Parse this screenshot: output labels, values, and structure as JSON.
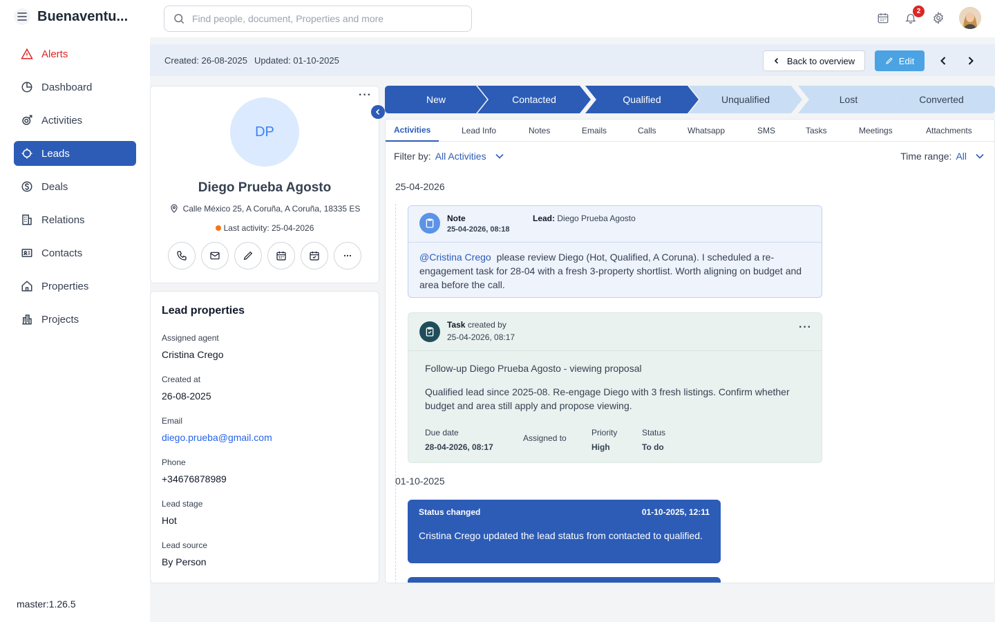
{
  "app": {
    "brand": "Buenaventu...",
    "version": "master:1.26.5"
  },
  "search": {
    "placeholder": "Find people, document, Properties and more"
  },
  "notifications": {
    "count": "2"
  },
  "nav": [
    {
      "label": "Alerts",
      "icon": "alert-triangle-icon"
    },
    {
      "label": "Dashboard",
      "icon": "pie-chart-icon"
    },
    {
      "label": "Activities",
      "icon": "activity-icon"
    },
    {
      "label": "Leads",
      "icon": "leads-icon"
    },
    {
      "label": "Deals",
      "icon": "dollar-icon"
    },
    {
      "label": "Relations",
      "icon": "building-icon"
    },
    {
      "label": "Contacts",
      "icon": "contact-card-icon"
    },
    {
      "label": "Properties",
      "icon": "home-icon"
    },
    {
      "label": "Projects",
      "icon": "city-icon"
    }
  ],
  "meta": {
    "created": "Created: 26-08-2025",
    "updated": "Updated: 01-10-2025"
  },
  "buttons": {
    "back": "Back to overview",
    "edit": "Edit"
  },
  "profile": {
    "initials": "DP",
    "name": "Diego Prueba Agosto",
    "address": "Calle México 25, A Coruña, A Coruña, 18335 ES",
    "last_activity": "Last activity: 25-04-2026"
  },
  "lead_properties": {
    "title": "Lead properties",
    "fields": [
      {
        "label": "Assigned agent",
        "value": "Cristina Crego"
      },
      {
        "label": "Created at",
        "value": "26-08-2025"
      },
      {
        "label": "Email",
        "value": "diego.prueba@gmail.com"
      },
      {
        "label": "Phone",
        "value": "+34676878989"
      },
      {
        "label": "Lead stage",
        "value": "Hot"
      },
      {
        "label": "Lead source",
        "value": "By Person"
      }
    ]
  },
  "stages": [
    "New",
    "Contacted",
    "Qualified",
    "Unqualified",
    "Lost",
    "Converted"
  ],
  "stage_colors": {
    "active": "#2c5cb6",
    "inactive": "#c9def4"
  },
  "tabs": [
    "Activities",
    "Lead Info",
    "Notes",
    "Emails",
    "Calls",
    "Whatsapp",
    "SMS",
    "Tasks",
    "Meetings",
    "Attachments"
  ],
  "filter": {
    "label": "Filter by:",
    "value": "All Activities"
  },
  "time_range": {
    "label": "Time range:",
    "value": "All"
  },
  "timeline": {
    "date1": "25-04-2026",
    "note": {
      "type": "Note",
      "date": "25-04-2026, 08:18",
      "lead_label": "Lead:",
      "lead_name": "Diego Prueba Agosto",
      "mention": "@Cristina Crego",
      "body": "please review Diego (Hot, Qualified, A Coruna). I scheduled a re-engagement task for 28-04 with a fresh 3-property shortlist. Worth aligning on budget and area before the call."
    },
    "task": {
      "type": "Task",
      "created_by": "created by",
      "date": "25-04-2026, 08:17",
      "title": "Follow-up Diego Prueba Agosto - viewing proposal",
      "description": "Qualified lead since 2025-08. Re-engage Diego with 3 fresh listings. Confirm whether budget and area still apply and propose viewing.",
      "due_label": "Due date",
      "due_value": "28-04-2026, 08:17",
      "assigned_label": "Assigned to",
      "priority_label": "Priority",
      "priority_value": "High",
      "status_label": "Status",
      "status_value": "To do"
    },
    "date2": "01-10-2025",
    "status_change": {
      "title": "Status changed",
      "date": "01-10-2025, 12:11",
      "body": "Cristina Crego updated the lead status from contacted to qualified."
    }
  }
}
